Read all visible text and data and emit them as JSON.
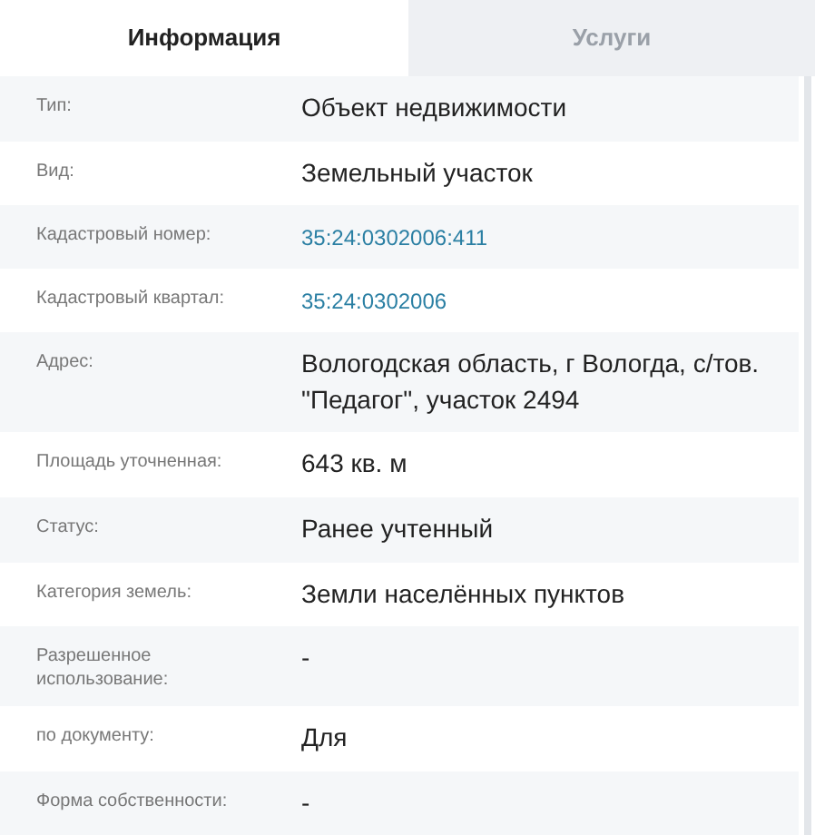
{
  "tabs": [
    {
      "label": "Информация",
      "selected": true
    },
    {
      "label": "Услуги",
      "selected": false
    }
  ],
  "rows": [
    {
      "label": "Тип:",
      "value": "Объект недвижимости",
      "kind": "text"
    },
    {
      "label": "Вид:",
      "value": "Земельный участок",
      "kind": "text"
    },
    {
      "label": "Кадастровый номер:",
      "value": "35:24:0302006:411",
      "kind": "link"
    },
    {
      "label": "Кадастровый квартал:",
      "value": "35:24:0302006",
      "kind": "link"
    },
    {
      "label": "Адрес:",
      "value": "Вологодская область, г Вологда, с/тов. \"Педагог\", участок 2494",
      "kind": "text"
    },
    {
      "label": "Площадь уточненная:",
      "value": "643 кв. м",
      "kind": "text"
    },
    {
      "label": "Статус:",
      "value": "Ранее учтенный",
      "kind": "text"
    },
    {
      "label": "Категория земель:",
      "value": "Земли населённых пунктов",
      "kind": "text"
    },
    {
      "label": "Разрешенное использование:",
      "value": "-",
      "kind": "text"
    },
    {
      "label": "по документу:",
      "value": "Для",
      "kind": "text"
    },
    {
      "label": "Форма собственности:",
      "value": "-",
      "kind": "text"
    }
  ]
}
